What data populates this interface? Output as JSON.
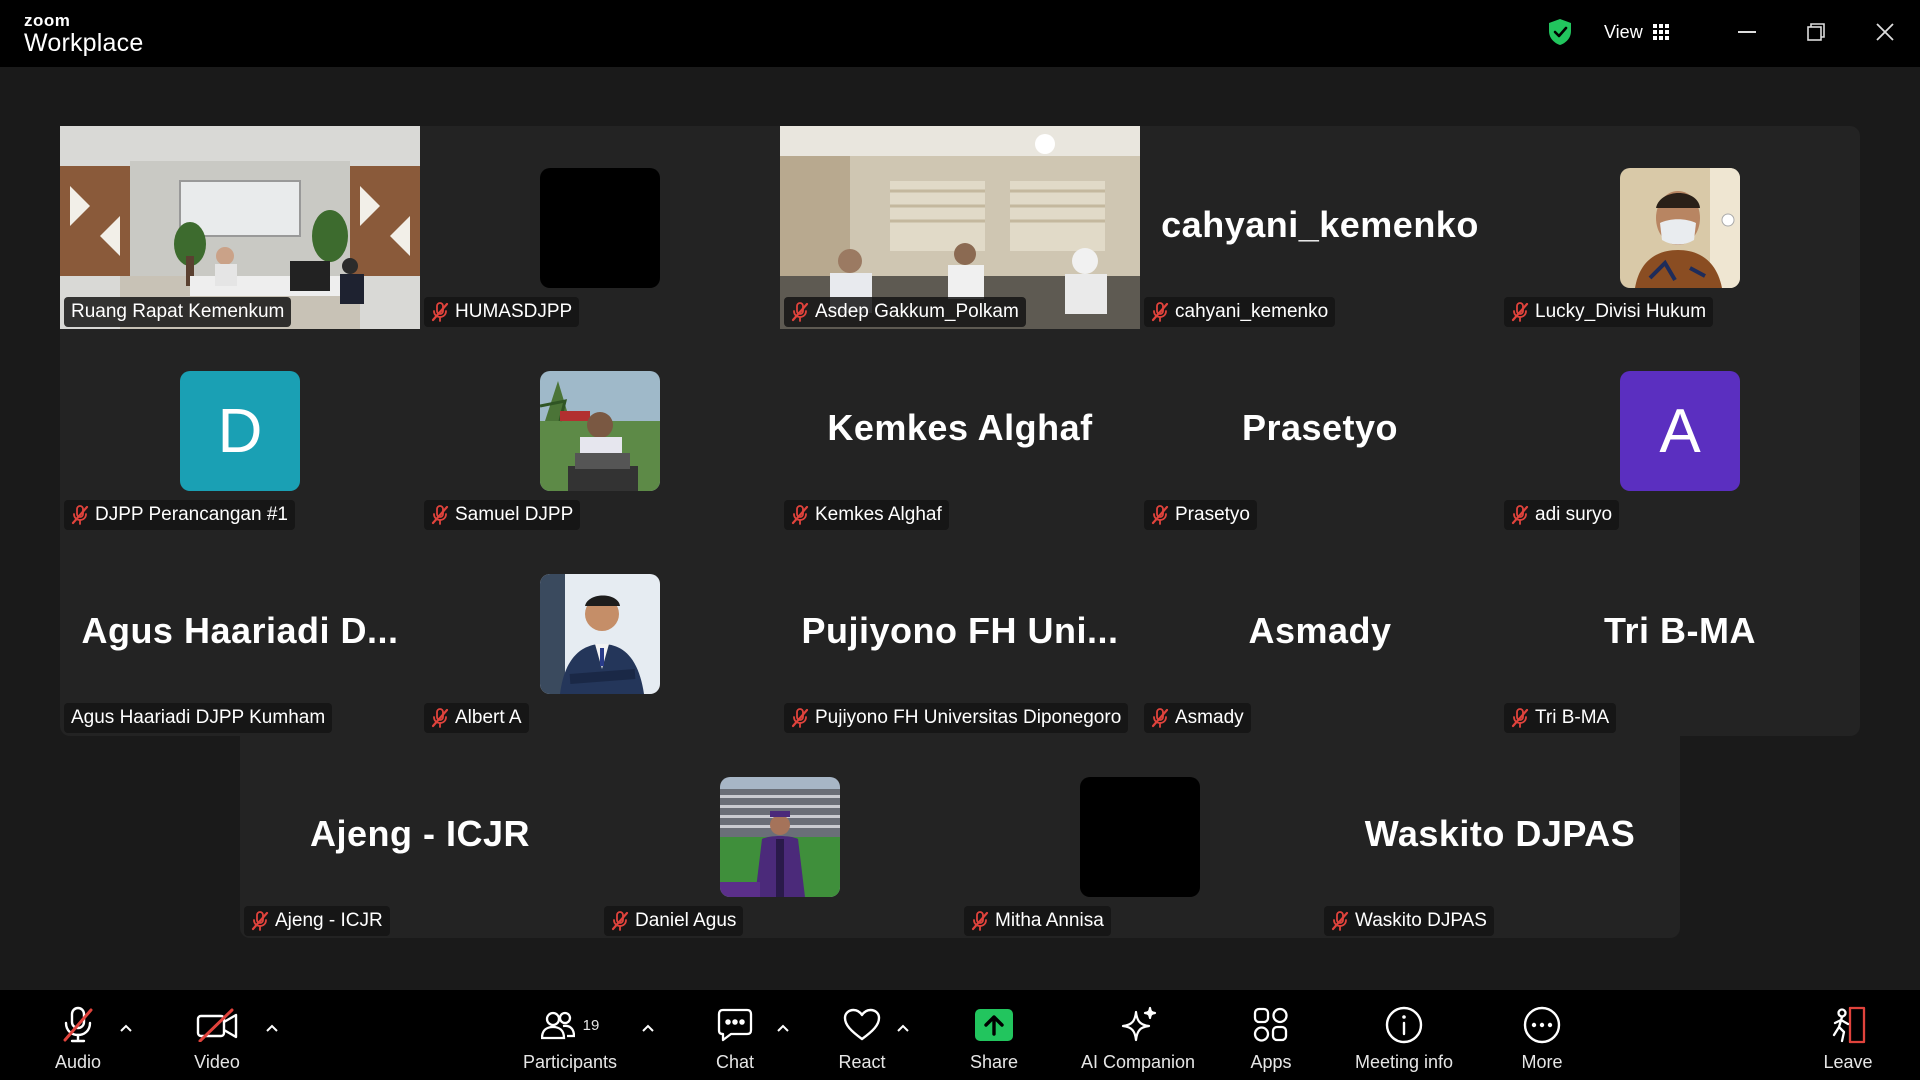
{
  "titlebar": {
    "brand_top": "zoom",
    "brand_bottom": "Workplace",
    "view_label": "View"
  },
  "tiles": [
    {
      "name": "Ruang Rapat Kemenkum",
      "muted": false,
      "kind": "video",
      "scene": "office-room",
      "active": true
    },
    {
      "name": "HUMASDJPP",
      "muted": true,
      "kind": "black-square"
    },
    {
      "name": "Asdep Gakkum_Polkam",
      "muted": true,
      "kind": "video",
      "scene": "meeting-room"
    },
    {
      "name": "cahyani_kemenko",
      "display": "cahyani_kemenko",
      "muted": true,
      "kind": "text"
    },
    {
      "name": "Lucky_Divisi Hukum",
      "muted": true,
      "kind": "photo",
      "scene": "masked-man"
    },
    {
      "name": "DJPP Perancangan #1",
      "muted": true,
      "kind": "initial",
      "initial": "D",
      "color": "#1aa0b4"
    },
    {
      "name": "Samuel DJPP",
      "muted": true,
      "kind": "photo",
      "scene": "outdoor-laptop"
    },
    {
      "name": "Kemkes Alghaf",
      "display": "Kemkes Alghaf",
      "muted": true,
      "kind": "text"
    },
    {
      "name": "Prasetyo",
      "display": "Prasetyo",
      "muted": true,
      "kind": "text"
    },
    {
      "name": "adi suryo",
      "muted": true,
      "kind": "initial",
      "initial": "A",
      "color": "#5b2fc0"
    },
    {
      "name": "Agus Haariadi DJPP Kumham",
      "display": "Agus  Haariadi  D...",
      "muted": false,
      "kind": "text"
    },
    {
      "name": "Albert A",
      "muted": true,
      "kind": "photo",
      "scene": "suit-portrait"
    },
    {
      "name": "Pujiyono FH Universitas Diponegoro",
      "display": "Pujiyono  FH  Uni...",
      "muted": true,
      "kind": "text"
    },
    {
      "name": "Asmady",
      "display": "Asmady",
      "muted": true,
      "kind": "text"
    },
    {
      "name": "Tri B-MA",
      "display": "Tri B-MA",
      "muted": true,
      "kind": "text"
    },
    {
      "name": "Ajeng - ICJR",
      "display": "Ajeng - ICJR",
      "muted": true,
      "kind": "text"
    },
    {
      "name": "Daniel Agus",
      "muted": true,
      "kind": "photo",
      "scene": "stadium-graduate"
    },
    {
      "name": "Mitha Annisa",
      "muted": true,
      "kind": "black-square"
    },
    {
      "name": "Waskito DJPAS",
      "display": "Waskito DJPAS",
      "muted": true,
      "kind": "text"
    }
  ],
  "toolbar": {
    "audio": "Audio",
    "video": "Video",
    "participants": "Participants",
    "participants_count": "19",
    "chat": "Chat",
    "react": "React",
    "share": "Share",
    "ai_companion": "AI Companion",
    "apps": "Apps",
    "meeting_info": "Meeting info",
    "more": "More",
    "leave": "Leave"
  },
  "colors": {
    "accent_green": "#2ed36a",
    "share_green": "#22c55e",
    "mute_red": "#e0433c",
    "leave_red": "#e0433c",
    "tile_bg": "#232323"
  }
}
